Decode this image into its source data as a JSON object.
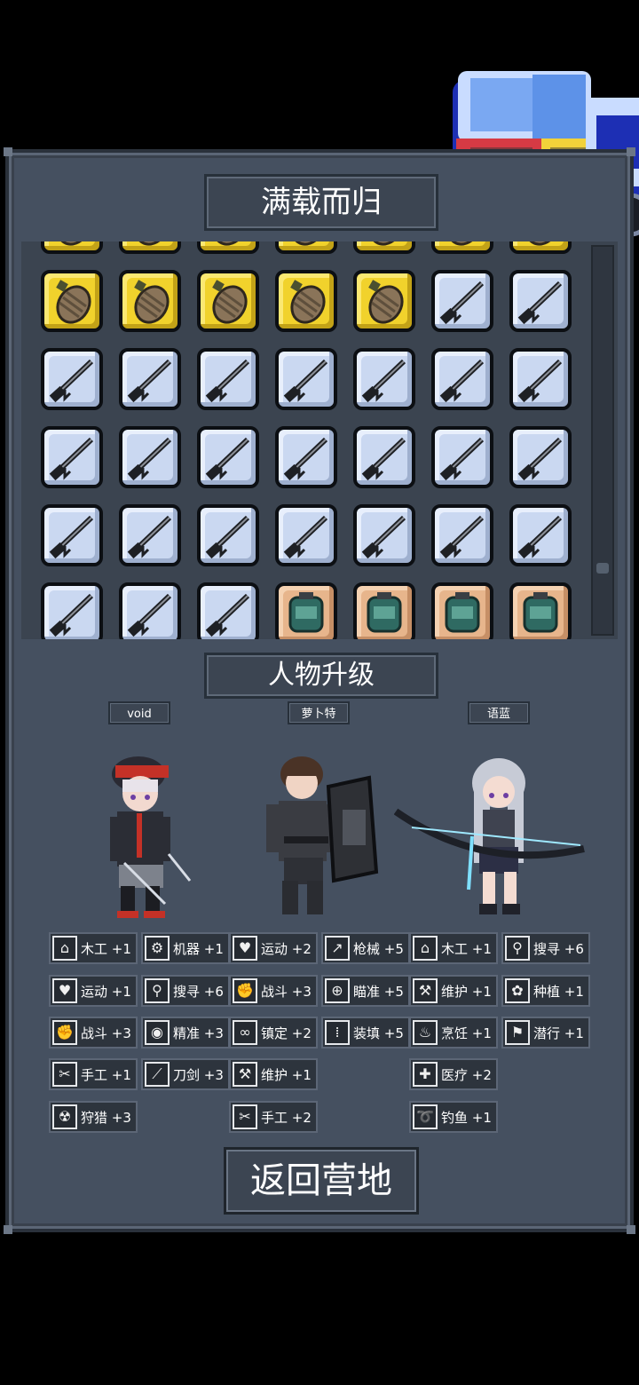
{
  "header": {
    "title": "满载而归"
  },
  "inventory": {
    "rows": [
      [
        "grenade",
        "grenade",
        "grenade",
        "grenade",
        "grenade",
        "grenade",
        "grenade"
      ],
      [
        "grenade",
        "grenade",
        "grenade",
        "grenade",
        "grenade",
        "rifle",
        "rifle"
      ],
      [
        "rifle",
        "rifle",
        "rifle",
        "rifle",
        "rifle",
        "rifle",
        "rifle"
      ],
      [
        "rifle",
        "rifle",
        "rifle",
        "rifle",
        "rifle",
        "rifle",
        "rifle"
      ],
      [
        "rifle",
        "rifle",
        "rifle",
        "rifle",
        "rifle",
        "rifle",
        "rifle"
      ],
      [
        "rifle",
        "rifle",
        "rifle",
        "pack",
        "pack",
        "pack",
        "pack"
      ]
    ]
  },
  "upgrade": {
    "title": "人物升级"
  },
  "characters": [
    {
      "name": "void"
    },
    {
      "name": "萝卜特"
    },
    {
      "name": "语蓝"
    }
  ],
  "skills": [
    {
      "icon": "house-icon",
      "glyph": "⌂",
      "label": "木工 +1"
    },
    {
      "icon": "gear-icon",
      "glyph": "⚙",
      "label": "机器 +1"
    },
    {
      "icon": "heart-icon",
      "glyph": "♥",
      "label": "运动 +2"
    },
    {
      "icon": "gun-icon",
      "glyph": "↗",
      "label": "枪械 +5"
    },
    {
      "icon": "house-icon",
      "glyph": "⌂",
      "label": "木工 +1"
    },
    {
      "icon": "magnifier-icon",
      "glyph": "⚲",
      "label": "搜寻 +6"
    },
    {
      "icon": "heart-icon",
      "glyph": "♥",
      "label": "运动 +1"
    },
    {
      "icon": "magnifier-icon",
      "glyph": "⚲",
      "label": "搜寻 +6"
    },
    {
      "icon": "fist-icon",
      "glyph": "✊",
      "label": "战斗 +3"
    },
    {
      "icon": "crosshair-icon",
      "glyph": "⊕",
      "label": "瞄准 +5"
    },
    {
      "icon": "wrench-icon",
      "glyph": "⚒",
      "label": "维护 +1"
    },
    {
      "icon": "flower-icon",
      "glyph": "✿",
      "label": "种植 +1"
    },
    {
      "icon": "fist-icon",
      "glyph": "✊",
      "label": "战斗 +3"
    },
    {
      "icon": "eye-icon",
      "glyph": "◉",
      "label": "精准 +3"
    },
    {
      "icon": "glasses-icon",
      "glyph": "∞",
      "label": "镇定 +2"
    },
    {
      "icon": "ammo-icon",
      "glyph": "⁞",
      "label": "装填 +5"
    },
    {
      "icon": "pot-icon",
      "glyph": "♨",
      "label": "烹饪 +1"
    },
    {
      "icon": "sneak-icon",
      "glyph": "⚑",
      "label": "潜行 +1"
    },
    {
      "icon": "scissors-icon",
      "glyph": "✂",
      "label": "手工 +1"
    },
    {
      "icon": "sword-icon",
      "glyph": "⟋",
      "label": "刀剑 +3"
    },
    {
      "icon": "wrench-icon",
      "glyph": "⚒",
      "label": "维护 +1"
    },
    {
      "icon": "medkit-icon",
      "glyph": "✚",
      "label": "医疗 +2"
    },
    {
      "icon": "hunting-icon",
      "glyph": "☢",
      "label": "狩猎 +3"
    },
    {
      "icon": "scissors-icon",
      "glyph": "✂",
      "label": "手工 +2"
    },
    {
      "icon": "fishing-icon",
      "glyph": "➰",
      "label": "钓鱼 +1"
    }
  ],
  "actions": {
    "return_label": "返回营地"
  },
  "colors": {
    "panel": "#455060",
    "grenade_bg": "#f1d22c",
    "rifle_bg": "#cad8f1",
    "pack_bg": "#e7b58c"
  }
}
